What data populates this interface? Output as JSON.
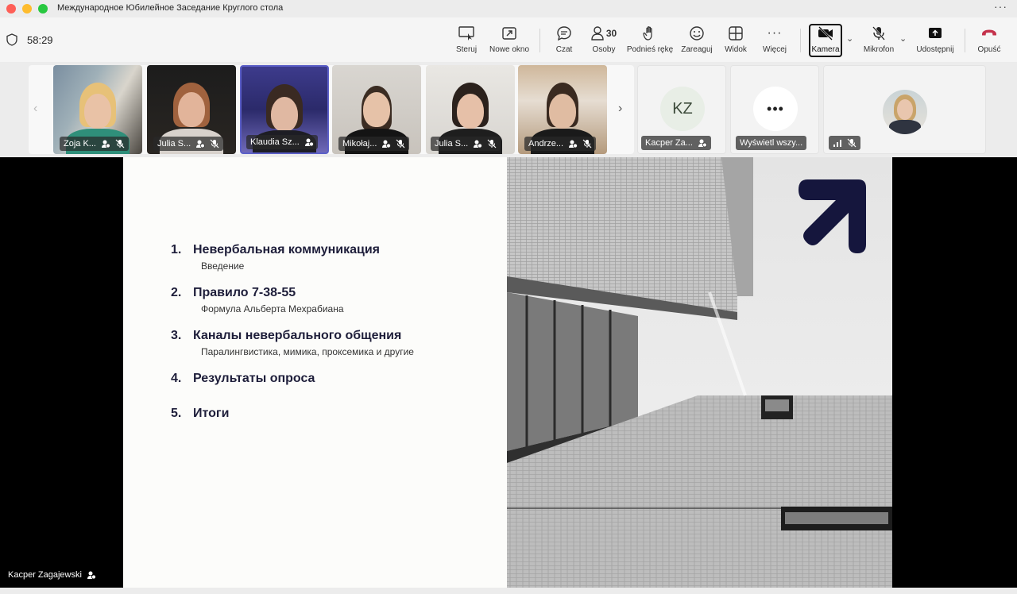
{
  "window": {
    "title": "Международное Юбилейное Заседание Круглого стола"
  },
  "toolbar": {
    "timer": "58:29",
    "steruj": "Steruj",
    "nowe_okno": "Nowe okno",
    "czat": "Czat",
    "osoby": "Osoby",
    "osoby_count": "30",
    "podnies_reke": "Podnieś rękę",
    "zareaguj": "Zareaguj",
    "widok": "Widok",
    "wiecej": "Więcej",
    "kamera": "Kamera",
    "mikrofon": "Mikrofon",
    "udostepnij": "Udostępnij",
    "opusc": "Opuść",
    "leave_color": "#c4314b"
  },
  "gallery": {
    "participants": [
      {
        "name": "Zoja K..."
      },
      {
        "name": "Julia S..."
      },
      {
        "name": "Klaudia Sz..."
      },
      {
        "name": "Mikołaj..."
      },
      {
        "name": "Julia S..."
      },
      {
        "name": "Andrze..."
      }
    ],
    "kacper_tile": {
      "initials": "KZ",
      "name": "Kacper Za..."
    },
    "show_all": {
      "label": "Wyświetl wszy..."
    },
    "selected_color": "#5b5fc7"
  },
  "slide": {
    "items": [
      {
        "num": "1.",
        "title": "Невербальная коммуникация",
        "sub": "Введение"
      },
      {
        "num": "2.",
        "title": "Правило 7-38-55",
        "sub": "Формула Альберта Мехрабиана"
      },
      {
        "num": "3.",
        "title": "Каналы невербального общения",
        "sub": "Паралингвистика, мимика, проксемика и другие"
      },
      {
        "num": "4.",
        "title": "Результаты опроса",
        "sub": ""
      },
      {
        "num": "5.",
        "title": "Итоги",
        "sub": ""
      }
    ],
    "logo_color": "#15163d"
  },
  "stage": {
    "presenter": "Kacper Zagajewski"
  }
}
